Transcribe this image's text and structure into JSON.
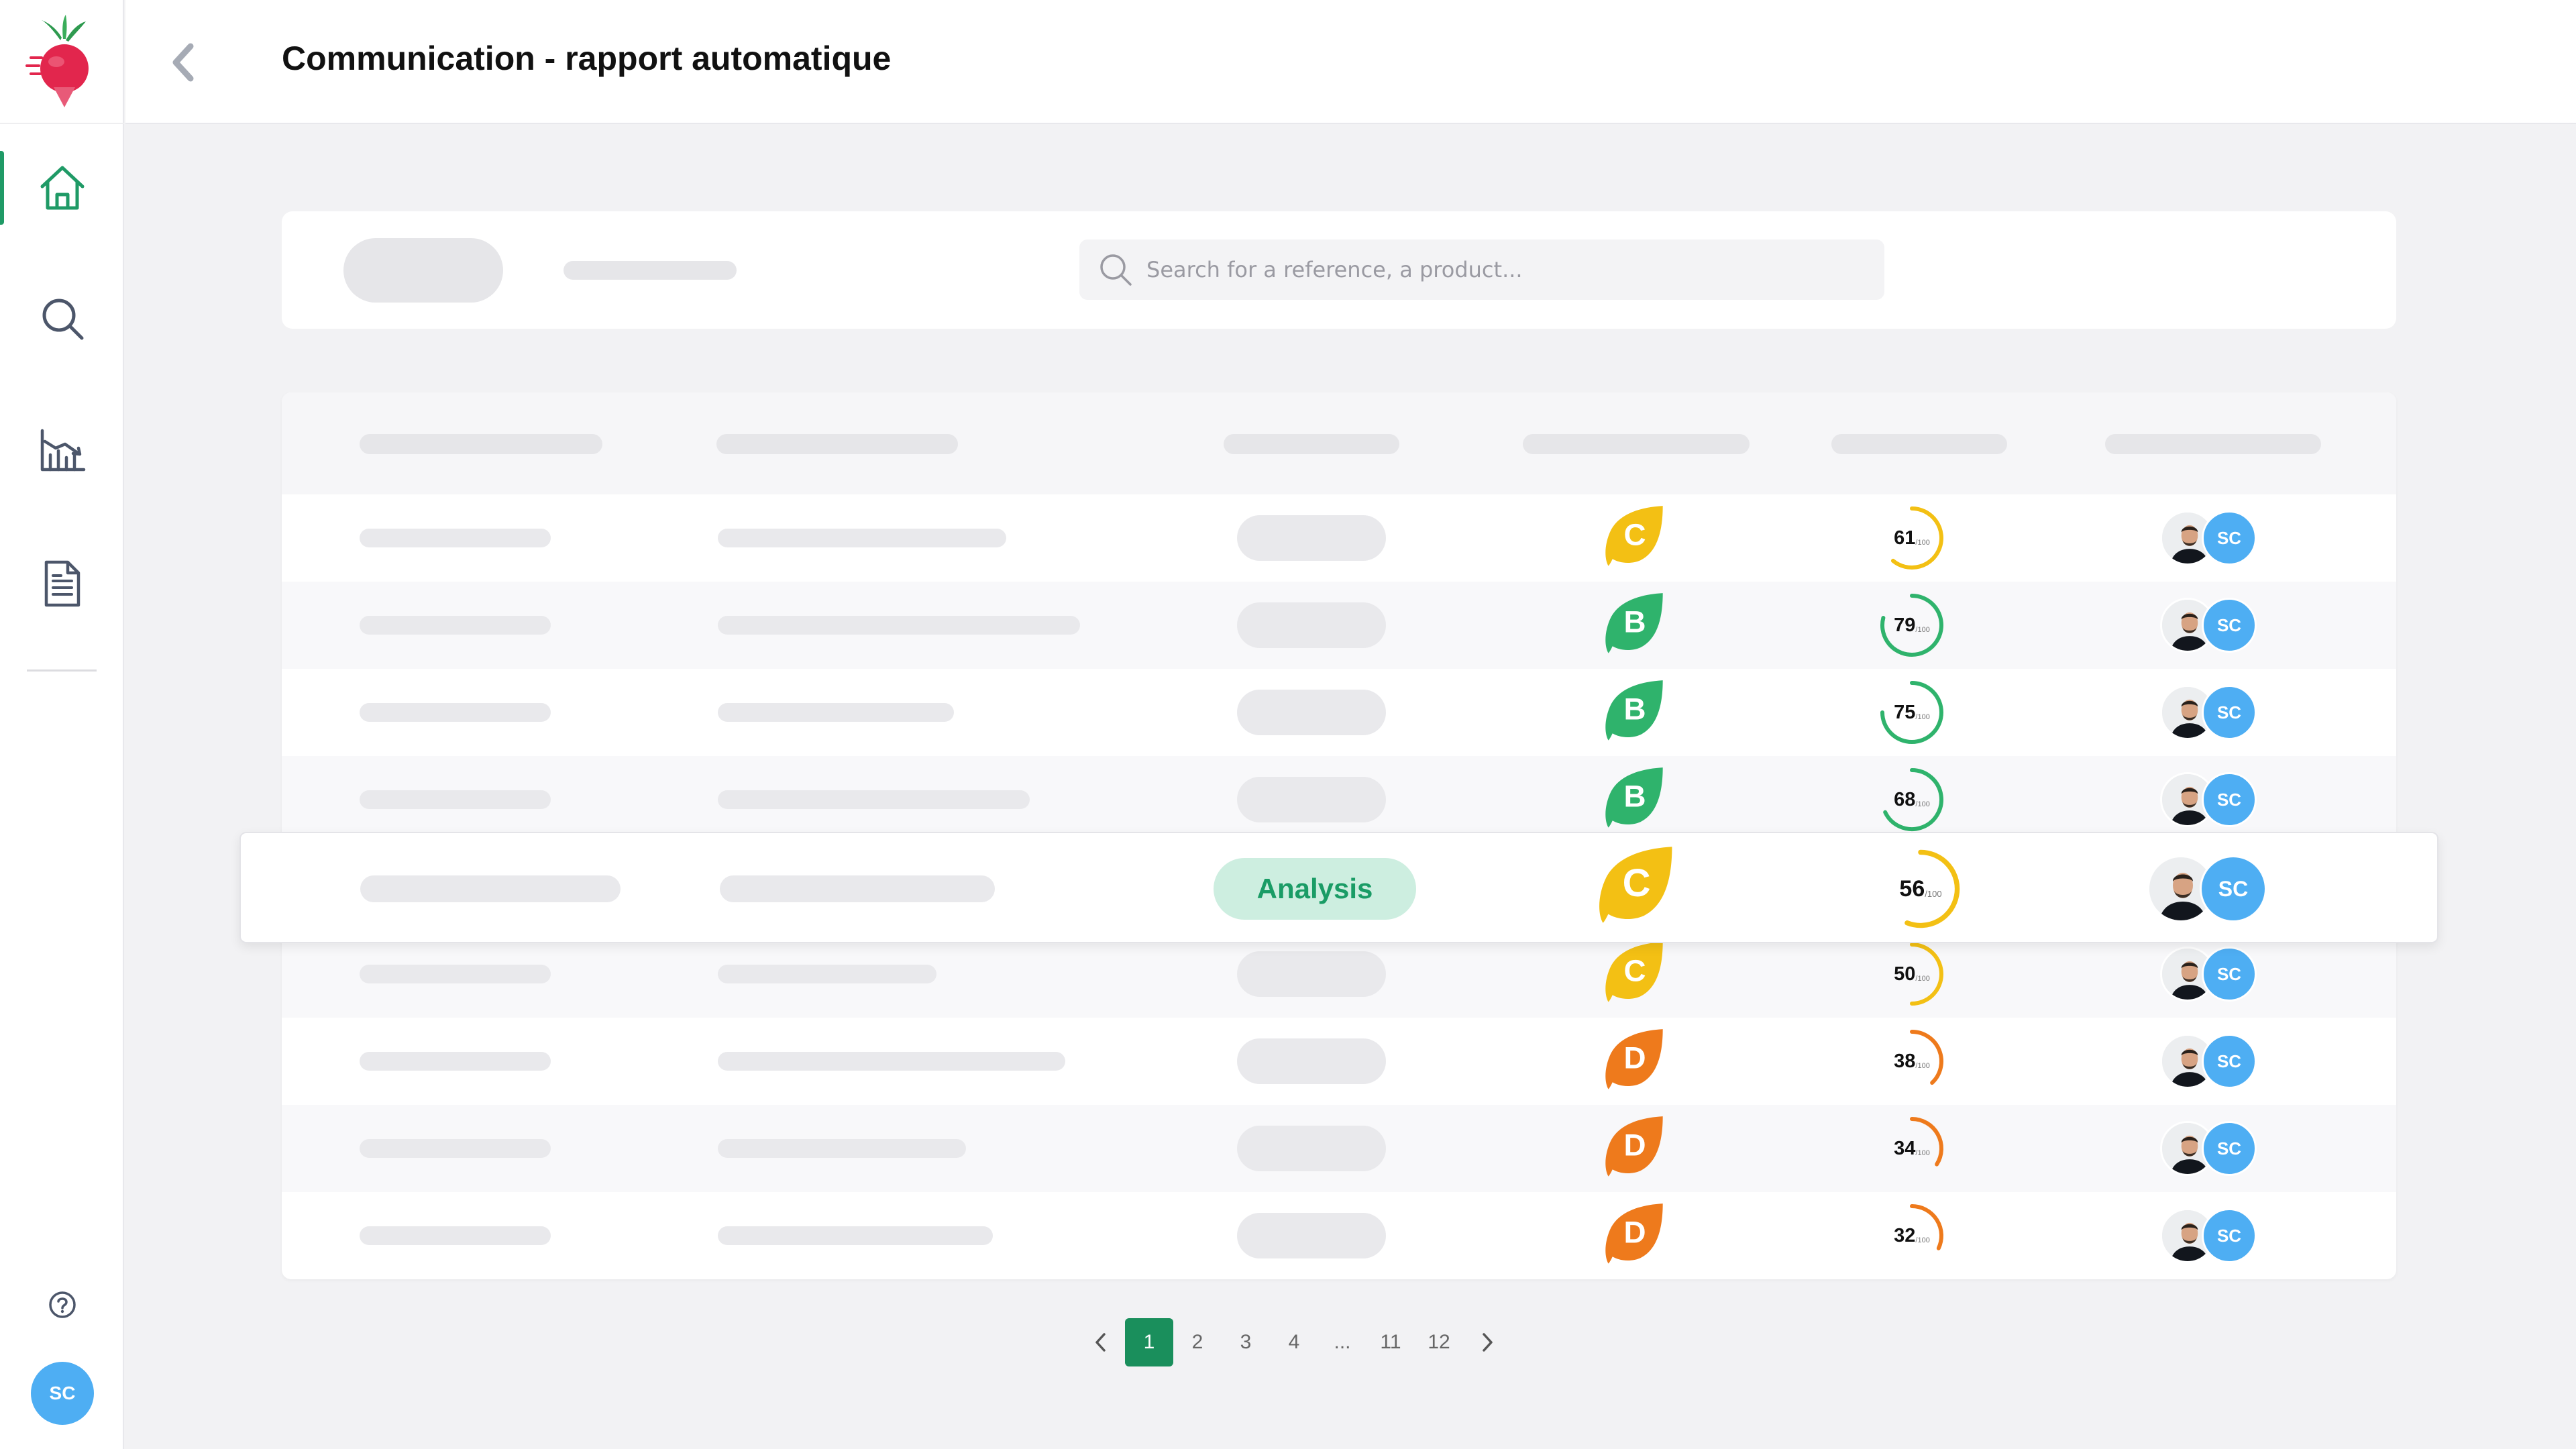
{
  "header": {
    "title": "Communication - rapport automatique"
  },
  "search": {
    "placeholder": "Search for a reference, a product..."
  },
  "sidebar": {
    "items": [
      {
        "name": "home",
        "icon": "home-icon",
        "active": true
      },
      {
        "name": "search",
        "icon": "search-icon",
        "active": false
      },
      {
        "name": "analytics",
        "icon": "chart-icon",
        "active": false
      },
      {
        "name": "documents",
        "icon": "document-icon",
        "active": false
      }
    ],
    "user_initials": "SC"
  },
  "colors": {
    "accent": "#1a8f5c",
    "grade_B": "#2fb36c",
    "grade_C": "#f3c014",
    "grade_D": "#ee7a1c",
    "avatar": "#4eaef3"
  },
  "rows": [
    {
      "grade": "C",
      "score": "61",
      "score_unit": "/100",
      "owner_initials": "SC"
    },
    {
      "grade": "B",
      "score": "79",
      "score_unit": "/100",
      "owner_initials": "SC"
    },
    {
      "grade": "B",
      "score": "75",
      "score_unit": "/100",
      "owner_initials": "SC"
    },
    {
      "grade": "B",
      "score": "68",
      "score_unit": "/100",
      "owner_initials": "SC"
    },
    {
      "grade": "C",
      "score": "56",
      "score_unit": "/100",
      "owner_initials": "SC",
      "status": "Analysis"
    },
    {
      "grade": "C",
      "score": "50",
      "score_unit": "/100",
      "owner_initials": "SC"
    },
    {
      "grade": "D",
      "score": "38",
      "score_unit": "/100",
      "owner_initials": "SC"
    },
    {
      "grade": "D",
      "score": "34",
      "score_unit": "/100",
      "owner_initials": "SC"
    },
    {
      "grade": "D",
      "score": "32",
      "score_unit": "/100",
      "owner_initials": "SC"
    }
  ],
  "pagination": {
    "pages": [
      "1",
      "2",
      "3",
      "4",
      "...",
      "11",
      "12"
    ],
    "current": "1"
  }
}
